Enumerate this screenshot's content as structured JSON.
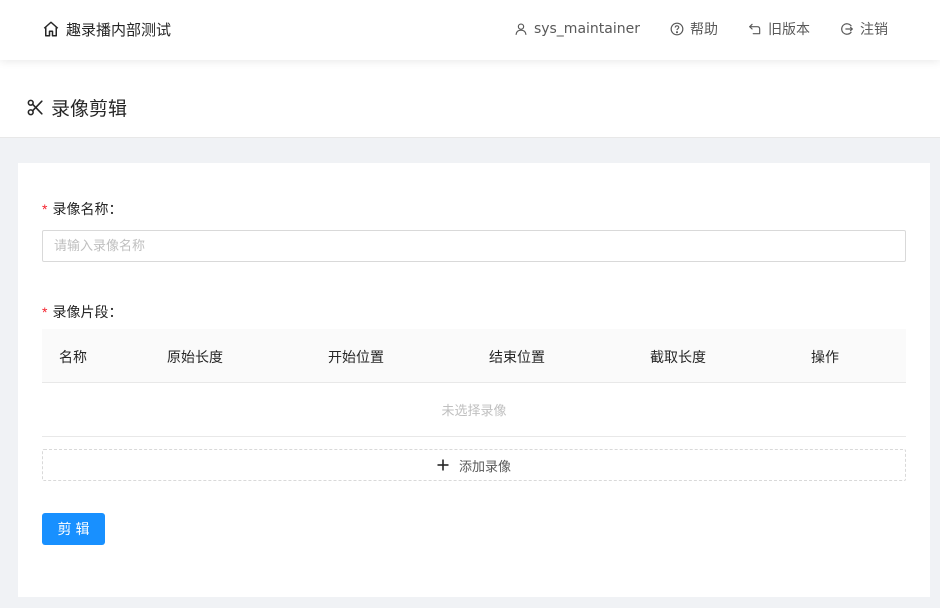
{
  "header": {
    "brand_title": "趣录播内部测试",
    "nav": [
      {
        "label": "sys_maintainer",
        "icon": "user-icon"
      },
      {
        "label": "帮助",
        "icon": "question-circle-icon"
      },
      {
        "label": "旧版本",
        "icon": "rollback-icon"
      },
      {
        "label": "注销",
        "icon": "logout-icon"
      }
    ]
  },
  "page": {
    "title": "录像剪辑",
    "icon": "scissor-icon"
  },
  "form": {
    "name_label": "录像名称：",
    "name_placeholder": "请输入录像名称",
    "name_value": "",
    "segments_label": "录像片段：",
    "table": {
      "columns": [
        "名称",
        "原始长度",
        "开始位置",
        "结束位置",
        "截取长度",
        "操作"
      ],
      "empty_text": "未选择录像"
    },
    "add_label": "添加录像",
    "submit_label": "剪辑"
  },
  "colors": {
    "primary": "#1890ff",
    "required": "#f5222d",
    "border": "#d9d9d9"
  }
}
